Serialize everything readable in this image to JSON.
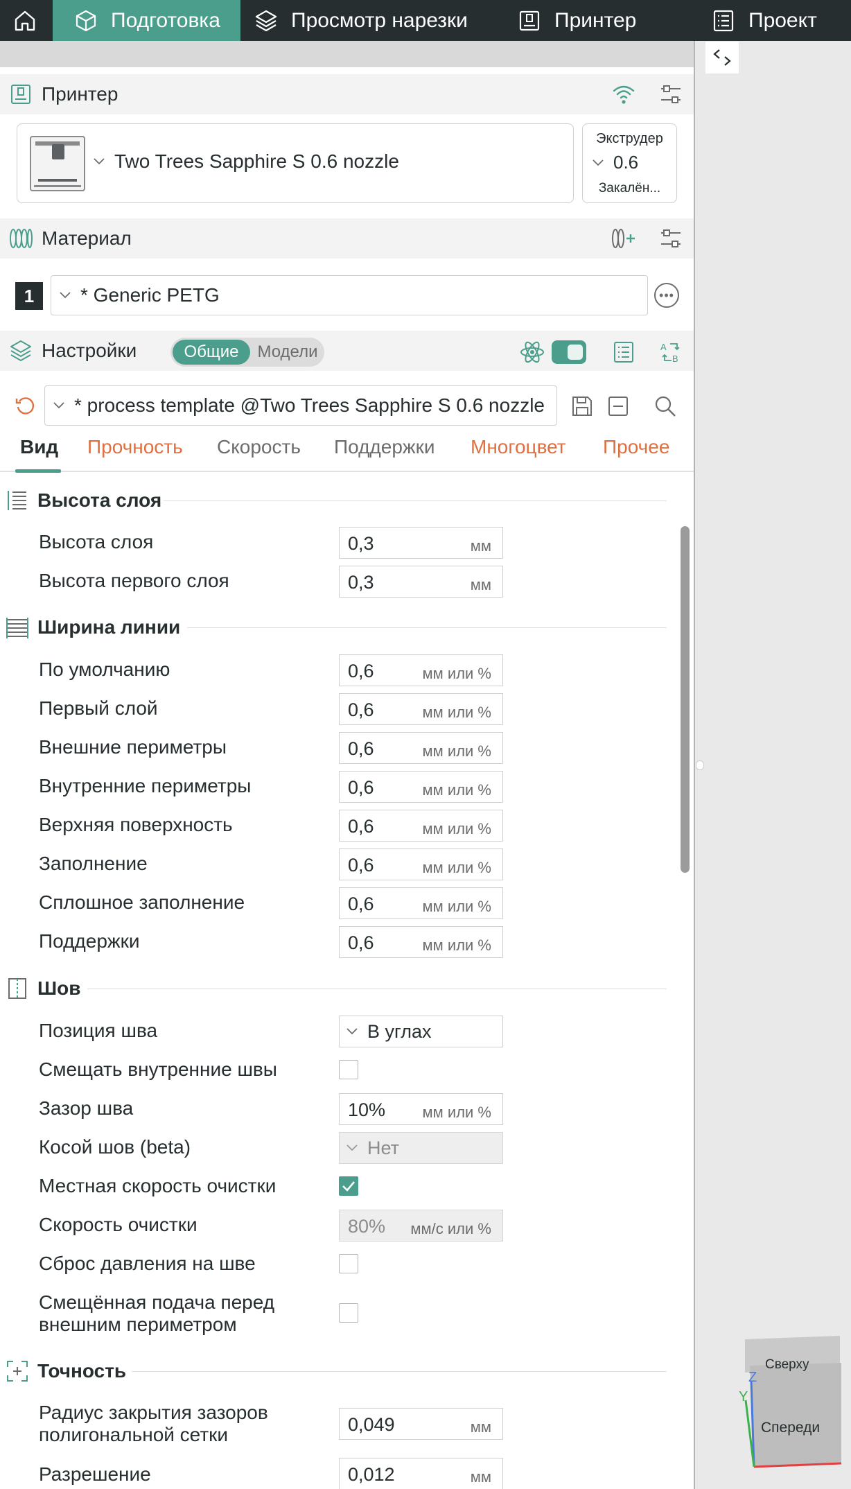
{
  "nav": {
    "tabs": [
      {
        "label": "Подготовка"
      },
      {
        "label": "Просмотр нарезки"
      },
      {
        "label": "Принтер"
      },
      {
        "label": "Проект"
      }
    ]
  },
  "printer_section": {
    "title": "Принтер",
    "printer_name": "Two Trees Sapphire S 0.6 nozzle",
    "extruder": {
      "title": "Экструдер",
      "value": "0.6",
      "sub": "Закалён..."
    }
  },
  "material_section": {
    "title": "Материал",
    "filament_index": "1",
    "filament_name": "* Generic PETG"
  },
  "settings_section": {
    "title": "Настройки",
    "toggle_on": "Общие",
    "toggle_off": "Модели",
    "preset": "* process template @Two Trees Sapphire S 0.6 nozzle"
  },
  "subtabs": [
    "Вид",
    "Прочность",
    "Скорость",
    "Поддержки",
    "Многоцвет",
    "Прочее"
  ],
  "groups": {
    "layer_height": {
      "title": "Высота слоя",
      "rows": [
        {
          "label": "Высота слоя",
          "value": "0,3",
          "unit": "мм"
        },
        {
          "label": "Высота первого слоя",
          "value": "0,3",
          "unit": "мм"
        }
      ]
    },
    "line_width": {
      "title": "Ширина линии",
      "rows": [
        {
          "label": "По умолчанию",
          "value": "0,6",
          "unit": "мм или %"
        },
        {
          "label": "Первый слой",
          "value": "0,6",
          "unit": "мм или %"
        },
        {
          "label": "Внешние периметры",
          "value": "0,6",
          "unit": "мм или %"
        },
        {
          "label": "Внутренние периметры",
          "value": "0,6",
          "unit": "мм или %"
        },
        {
          "label": "Верхняя поверхность",
          "value": "0,6",
          "unit": "мм или %"
        },
        {
          "label": "Заполнение",
          "value": "0,6",
          "unit": "мм или %"
        },
        {
          "label": "Сплошное заполнение",
          "value": "0,6",
          "unit": "мм или %"
        },
        {
          "label": "Поддержки",
          "value": "0,6",
          "unit": "мм или %"
        }
      ]
    },
    "seam": {
      "title": "Шов",
      "rows": [
        {
          "label": "Позиция шва",
          "value": "В углах"
        },
        {
          "label": "Смещать внутренние швы",
          "checked": false
        },
        {
          "label": "Зазор шва",
          "value": "10%",
          "unit": "мм или %"
        },
        {
          "label": "Косой шов (beta)",
          "value": "Нет"
        },
        {
          "label": "Местная скорость очистки",
          "checked": true
        },
        {
          "label": "Скорость очистки",
          "value": "80%",
          "unit": "мм/с или %"
        },
        {
          "label": "Сброс давления на шве",
          "checked": false
        },
        {
          "label_line1": "Смещённая подача перед",
          "label_line2": "внешним периметром",
          "checked": false
        }
      ]
    },
    "precision": {
      "title": "Точность",
      "rows": [
        {
          "label_line1": "Радиус закрытия зазоров",
          "label_line2": "полигональной сетки",
          "value": "0,049",
          "unit": "мм"
        },
        {
          "label": "Разрешение",
          "value": "0,012",
          "unit": "мм"
        }
      ]
    }
  },
  "view_cube": {
    "top": "Сверху",
    "front": "Спереди",
    "axis_z": "Z",
    "axis_y": "Y"
  },
  "colors": {
    "accent": "#4b9e8c",
    "nav_bg": "#262e30",
    "orange": "#e07040"
  }
}
